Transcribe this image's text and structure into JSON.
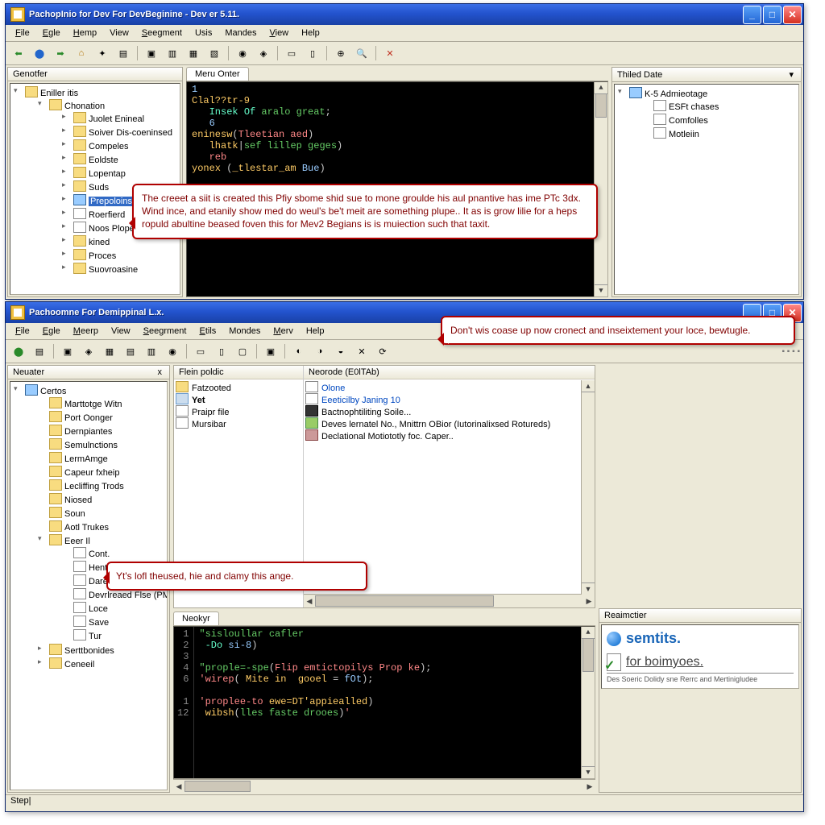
{
  "win1": {
    "title": "PachopInio for Dev For DevBeginine - Dev er 5.11.",
    "menus": [
      "File",
      "Egle",
      "Hemp",
      "View",
      "Seegment",
      "Usis",
      "Mandes",
      "View",
      "Help"
    ],
    "left_panel": "Genotfer",
    "tree_root": "Eniller itis",
    "tree_group": "Chonation",
    "tree_items": [
      "Juolet Enineal",
      "Soiver Dis-coeninsed",
      "Compeles",
      "Eoldste",
      "Lopentap",
      "Suds",
      "Prepoloins",
      "Roerfierd",
      "Noos Plope",
      "kined",
      "Proces",
      "Suovroasine"
    ],
    "tree_selected_index": 6,
    "editor_tab": "Meru Onter",
    "code_lines": [
      "1",
      "Clal??tr-9",
      "   Insek Of aralo great;",
      "   6",
      "eninesw(Tleetian aed)",
      "   lhatk|sef lillep geges)",
      "   reb",
      "yonex (_tlestar_am Bue)"
    ],
    "right_panel": "Thiled Date",
    "right_root": "K-5 Admieotage",
    "right_items": [
      "ESFt chases",
      "Comfolles",
      "Motleiin"
    ]
  },
  "win2": {
    "title": "Pachoomne For Demippinal L.x.",
    "menus": [
      "File",
      "Egle",
      "Meerp",
      "View",
      "Seegrment",
      "Etils",
      "Mondes",
      "Merv",
      "Help"
    ],
    "left_panel": "Neuater",
    "tree_root": "Certos",
    "tree_items1": [
      "Marttotge Witn",
      "Port Oonger",
      "Dernpiantes",
      "Semulnctions",
      "LermAmge",
      "Capeur fxheip",
      "Lecliffing Trods",
      "Niosed",
      "Soun",
      "Aotl Trukes"
    ],
    "tree_group2": "Eeer Il",
    "tree_items2": [
      "Cont.",
      "Hente-",
      "Darees",
      "Devrlreaed Flse (PMP)",
      "Loce",
      "Save",
      "Tur"
    ],
    "tree_items3": [
      "Serttbonides",
      "Ceneeil"
    ],
    "filecol_header": "Flein poldic",
    "filecol_items": [
      "Fatzooted",
      "Yet",
      "Praipr file",
      "Mursibar"
    ],
    "mainlist_header": "Neorode (E0lTAb)",
    "mainlist_items": [
      "Olone",
      "Eeeticilby Janing 10",
      "Bactnophtiliting Soile...",
      "Deves lernatel No., Mnittrn OBior (Iutorinalixsed Rotureds)",
      "Declational Motiototly foc. Caper.."
    ],
    "code_tab": "Neokyr",
    "code_gutter": [
      "1",
      "2",
      "3",
      "4",
      "6",
      "",
      "1",
      "12",
      ""
    ],
    "code_lines": [
      "\"sisloullar cafler",
      " -Do si-8)",
      "",
      "\"prople=-spe(Flip emtictopilys Prop ke);",
      "'wirep( Mite in  gooel = fOt);",
      "",
      "'proplee-to ewe=DT'appiealled)",
      " wibsh(lles faste drooes)'"
    ],
    "right_panel": "Reaimctier",
    "brand1": "semtits.",
    "brand2": "for boimyoes.",
    "brand_sub": "Des Soeric Dolidy sne Rerrc and Mertinigludee",
    "status": "Step"
  },
  "callouts": {
    "c1": "The creeet a siit is created this Pfiy sbome shid sue to mone groulde his aul pnantive has ime PTc 3dx. Wind ince, and etanily show med do weul's be't meit are something plupe..  It as is grow lilie for a heps ropuld abultine beased foven this for Mev2 Begians is is muiection such that taxit.",
    "c2": "Don't wis coase up now cronect and inseixtement your loce, bewtugle.",
    "c3": "Yt's lofl theused, hie and clamy this ange."
  }
}
